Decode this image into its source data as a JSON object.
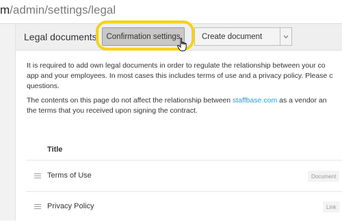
{
  "browser": {
    "url_prefix": "m",
    "url_path": "/admin/settings/legal"
  },
  "header": {
    "title": "Legal documents",
    "confirmation_button": "Confirmation settings",
    "create_button": "Create document",
    "create_caret_icon": "chevron-down-icon"
  },
  "intro": {
    "lines": [
      "It is required to add own legal documents in order to regulate the relationship between your co",
      "app and your employees. In most cases this includes terms of use and a privacy policy. Please c",
      "questions."
    ]
  },
  "note": {
    "line1_prefix": "The contents on this page do not affect the relationship between ",
    "line1_link": "staffbase.com",
    "line1_suffix": " as a vendor an",
    "line2": "the terms that you received upon signing the contract."
  },
  "table": {
    "column_title": "Title",
    "rows": [
      {
        "title": "Terms of Use",
        "type": "Document"
      },
      {
        "title": "Privacy Policy",
        "type": "Link"
      }
    ]
  },
  "colors": {
    "highlight": "#f4d21a",
    "link": "#2a9ad6"
  }
}
